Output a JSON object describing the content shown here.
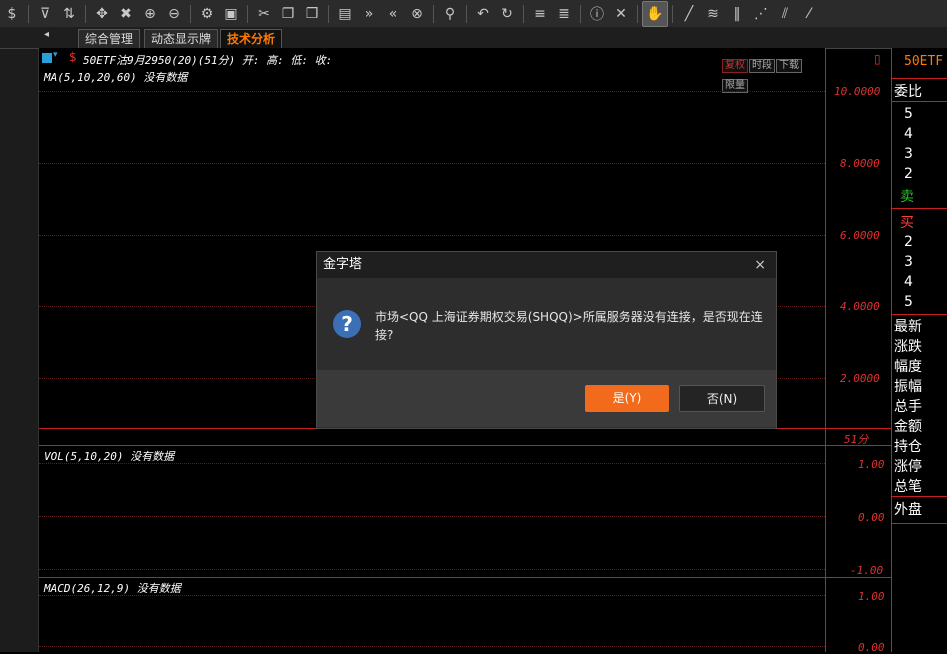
{
  "toolbar": {
    "icons": [
      "$",
      "⊽",
      "⇅",
      "✥",
      "✖",
      "⊕",
      "⊖",
      "⚙",
      "▣",
      "✂",
      "❐",
      "❒",
      "▤",
      "»",
      "«",
      "⊗",
      "⚲",
      "↶",
      "↻",
      "≡",
      "≣",
      "ⓘ",
      "✕",
      "✋",
      "╱",
      "≋",
      "‖",
      "⋰",
      "⫽",
      "⁄"
    ]
  },
  "left_strip": {
    "label1": "中",
    "label2": "✕"
  },
  "tabs": [
    "综合管理",
    "动态显示牌",
    "技术分析"
  ],
  "chart": {
    "header": "50ETF沽9月2950(20)(51分) 开: 高: 低: 收:",
    "ma_label": "MA(5,10,20,60)   没有数据",
    "vol_label": "VOL(5,10,20)   没有数据",
    "macd_label": "MACD(26,12,9)   没有数据",
    "corner_buttons": [
      "复权",
      "时段",
      "下载",
      "限量"
    ],
    "period_label": "51分",
    "y_main": [
      "10.0000",
      "8.0000",
      "6.0000",
      "4.0000",
      "2.0000"
    ],
    "y_vol": [
      "1.00",
      "0.00",
      "-1.00"
    ],
    "y_macd": [
      "1.00",
      "0.00"
    ]
  },
  "right_panel": {
    "title": "50ETF",
    "weibi": "委比",
    "sell_levels": [
      "5",
      "4",
      "3",
      "2"
    ],
    "sell_label": "卖",
    "buy_label": "买",
    "buy_levels": [
      "2",
      "3",
      "4",
      "5"
    ],
    "fields": [
      "最新",
      "涨跌",
      "幅度",
      "振幅",
      "总手",
      "金额",
      "持仓",
      "涨停",
      "总笔"
    ],
    "outer": "外盘",
    "colors": {
      "sell": "#22c022",
      "buy": "#ff3a3a"
    }
  },
  "dialog": {
    "title": "金字塔",
    "message": "市场<QQ 上海证券期权交易(SHQQ)>所属服务器没有连接，是否现在连接?",
    "yes_label": "是(Y)",
    "no_label": "否(N)",
    "close_icon": "×"
  }
}
